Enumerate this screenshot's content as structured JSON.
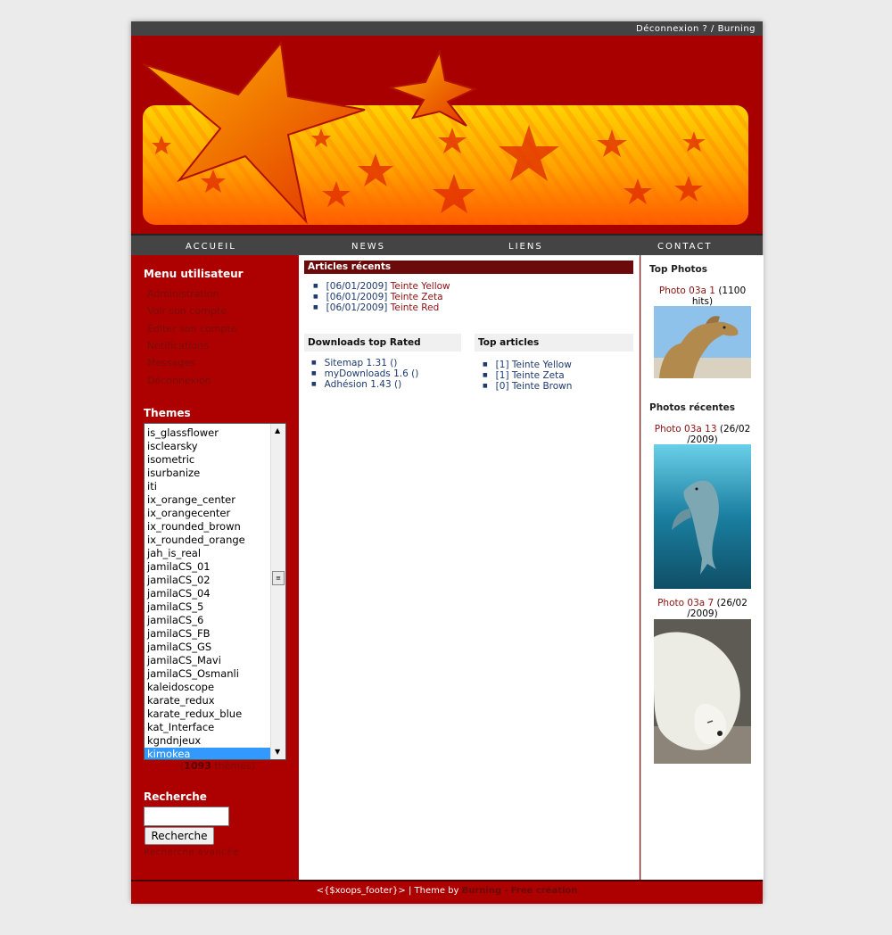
{
  "topbar": {
    "logout": "Déconnexion ?",
    "sep": "/",
    "user": "Burning"
  },
  "nav": {
    "items": [
      "ACCUEIL",
      "NEWS",
      "LIENS",
      "CONTACT"
    ]
  },
  "user_menu": {
    "title": "Menu utilisateur",
    "items": [
      "Administration",
      "Voir son compte",
      "Éditer son compte",
      "Notifications",
      "Messages",
      "Déconnexion"
    ]
  },
  "themes": {
    "title": "Themes",
    "options": [
      "is_glassflower",
      "isclearsky",
      "isometric",
      "isurbanize",
      "iti",
      "ix_orange_center",
      "ix_orangecenter",
      "ix_rounded_brown",
      "ix_rounded_orange",
      "jah_is_real",
      "jamilaCS_01",
      "jamilaCS_02",
      "jamilaCS_04",
      "jamilaCS_5",
      "jamilaCS_6",
      "jamilaCS_FB",
      "jamilaCS_GS",
      "jamilaCS_Mavi",
      "jamilaCS_Osmanli",
      "kaleidoscope",
      "karate_redux",
      "karate_redux_blue",
      "kat_Interface",
      "kgndnjeux",
      "kimokea"
    ],
    "selected": "kimokea",
    "count_open": "(",
    "count": "1093",
    "count_label": "thèmes)"
  },
  "search": {
    "title": "Recherche",
    "button": "Recherche",
    "input_value": "",
    "advanced": "Recherche avancée"
  },
  "recent_articles": {
    "title": "Articles récents",
    "items": [
      {
        "date": "[06/01/2009]",
        "title": "Teinte Yellow"
      },
      {
        "date": "[06/01/2009]",
        "title": "Teinte Zeta"
      },
      {
        "date": "[06/01/2009]",
        "title": "Teinte Red"
      }
    ]
  },
  "downloads": {
    "title": "Downloads top Rated",
    "items": [
      "Sitemap 1.31 ()",
      "myDownloads 1.6 ()",
      "Adhésion 1.43 ()"
    ]
  },
  "top_articles": {
    "title": "Top articles",
    "items": [
      {
        "rank": "[1]",
        "title": "Teinte Yellow"
      },
      {
        "rank": "[1]",
        "title": "Teinte Zeta"
      },
      {
        "rank": "[0]",
        "title": "Teinte Brown"
      }
    ]
  },
  "top_photos": {
    "title": "Top Photos",
    "items": [
      {
        "name": "Photo 03a 1",
        "line1": "(1100",
        "line2": "hits)"
      }
    ]
  },
  "recent_photos": {
    "title": "Photos récentes",
    "items": [
      {
        "name": "Photo 03a 13",
        "line1": "(26/02",
        "line2": "/2009)"
      },
      {
        "name": "Photo 03a 7",
        "line1": "(26/02",
        "line2": "/2009)"
      }
    ]
  },
  "footer": {
    "left": "<{$xoops_footer}> | Theme by",
    "author": "Burning",
    "sep": "-",
    "link": "Free création"
  },
  "colors": {
    "page_bg": "#ebebeb",
    "primary_red": "#ad0000",
    "dark_bar": "#444444",
    "accent_dark": "#6b0a0a",
    "link_blue": "#1e3a6e"
  }
}
